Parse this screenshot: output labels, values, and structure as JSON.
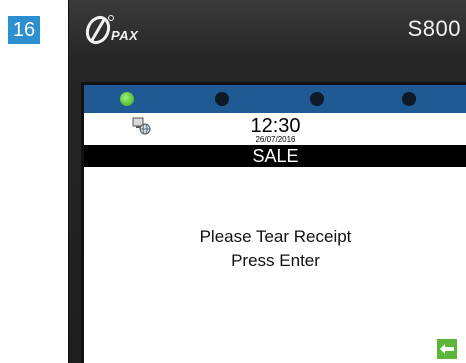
{
  "step_number": "16",
  "device": {
    "brand": "PAX",
    "model": "S800"
  },
  "screen": {
    "leds": [
      "green",
      "off",
      "off",
      "off"
    ],
    "time": "12:30",
    "date": "26/07/2016",
    "title": "SALE",
    "message_line1": "Please Tear Receipt",
    "message_line2": "Press Enter",
    "icons": {
      "network": "network-globe-icon",
      "enter": "enter-arrow-icon"
    }
  },
  "colors": {
    "badge": "#2e8fd0",
    "led_bar": "#1f5a95",
    "led_on": "#3aa21a",
    "enter_button": "#5cb63a"
  }
}
